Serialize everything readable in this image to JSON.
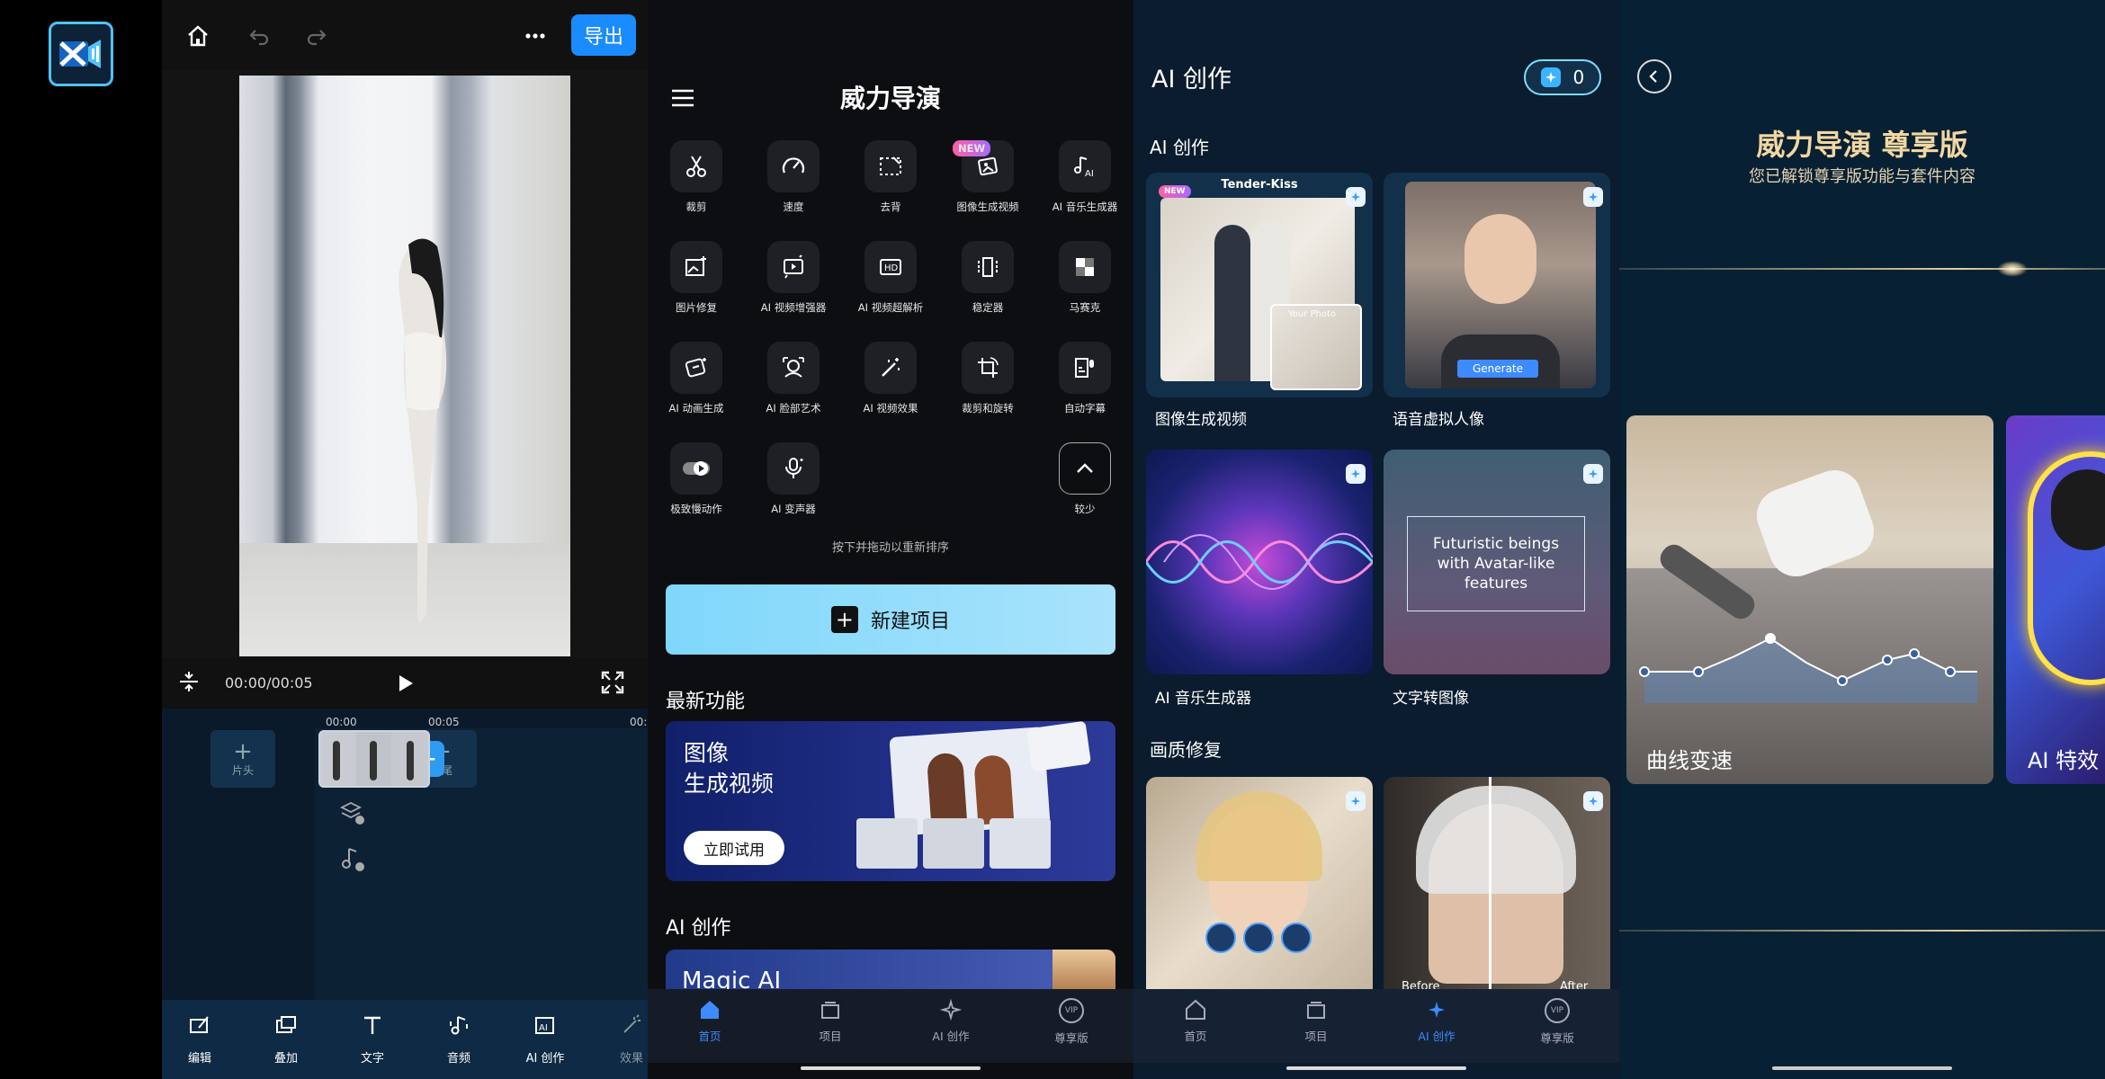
{
  "editor": {
    "export_label": "导出",
    "timecode": "00:00/00:05",
    "ruler": [
      "00:00",
      "00:05",
      "00:"
    ],
    "clip_head_label": "片头",
    "clip_tail_label": "片尾",
    "bottom_tabs": [
      "编辑",
      "叠加",
      "文字",
      "音频",
      "AI 创作",
      "效果"
    ]
  },
  "home": {
    "title": "威力导演",
    "tools": [
      {
        "label": "裁剪",
        "icon": "scissors-icon"
      },
      {
        "label": "速度",
        "icon": "speedometer-icon"
      },
      {
        "label": "去背",
        "icon": "remove-bg-icon"
      },
      {
        "label": "图像生成视频",
        "icon": "image-to-video-icon",
        "badge": "NEW"
      },
      {
        "label": "AI 音乐生成器",
        "icon": "ai-music-icon"
      },
      {
        "label": "图片修复",
        "icon": "photo-repair-icon"
      },
      {
        "label": "AI 视频增强器",
        "icon": "video-enhancer-icon"
      },
      {
        "label": "AI 视频超解析",
        "icon": "hd-icon"
      },
      {
        "label": "稳定器",
        "icon": "stabilizer-icon"
      },
      {
        "label": "马赛克",
        "icon": "mosaic-icon"
      },
      {
        "label": "AI 动画生成",
        "icon": "ai-animation-icon"
      },
      {
        "label": "AI 脸部艺术",
        "icon": "face-art-icon"
      },
      {
        "label": "AI 视频效果",
        "icon": "magic-wand-icon"
      },
      {
        "label": "裁剪和旋转",
        "icon": "crop-rotate-icon"
      },
      {
        "label": "自动字幕",
        "icon": "auto-caption-icon"
      },
      {
        "label": "极致慢动作",
        "icon": "slow-motion-icon"
      },
      {
        "label": "AI 变声器",
        "icon": "voice-changer-icon"
      }
    ],
    "collapse_label": "较少",
    "reorder_hint": "按下并拖动以重新排序",
    "new_project": "新建项目",
    "latest_title": "最新功能",
    "banner_line1": "图像",
    "banner_line2": "生成视频",
    "try_now": "立即试用",
    "ai_section": "AI 创作",
    "magic_title": "Magic AI",
    "nav": [
      "首页",
      "项目",
      "AI 创作",
      "尊享版"
    ],
    "vip_badge": "VIP"
  },
  "ai": {
    "title": "AI 创作",
    "credit_count": "0",
    "section1": "AI 创作",
    "cards": [
      {
        "label": "图像生成视频",
        "tag": "Tender-Kiss",
        "badge": "NEW",
        "overlay": "Your Photo"
      },
      {
        "label": "语音虚拟人像",
        "overlay": "Generate"
      },
      {
        "label": "AI 音乐生成器"
      },
      {
        "label": "文字转图像",
        "overlay": "Futuristic beings with Avatar-like features"
      }
    ],
    "section2": "画质修复",
    "before": "Before",
    "after": "After",
    "nav": [
      "首页",
      "项目",
      "AI 创作",
      "尊享版"
    ]
  },
  "vip": {
    "title": "威力导演 尊享版",
    "subtitle": "您已解锁尊享版功能与套件内容",
    "card1": "曲线变速",
    "card2": "AI 特效"
  },
  "colors": {
    "accent": "#1a8cff",
    "gold": "#f2d7a2",
    "active_nav": "#3d8bff"
  }
}
